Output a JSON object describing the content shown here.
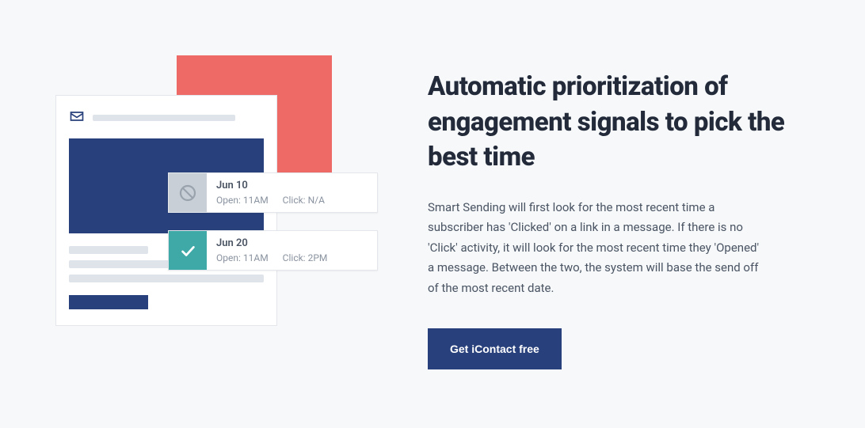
{
  "heading": "Automatic prioritization of engagement signals to pick the best time",
  "body": "Smart Sending will first look for the most recent time a subscriber has 'Clicked' on a link in a message. If there is no 'Click' activity, it will look for the most recent time they 'Opened' a message. Between the two, the system will base the send off of the most recent date.",
  "cta_label": "Get iContact free",
  "cards": [
    {
      "date": "Jun 10",
      "open_label": "Open:",
      "open_value": "11AM",
      "click_label": "Click:",
      "click_value": "N/A"
    },
    {
      "date": "Jun 20",
      "open_label": "Open:",
      "open_value": "11AM",
      "click_label": "Click:",
      "click_value": "2PM"
    }
  ]
}
